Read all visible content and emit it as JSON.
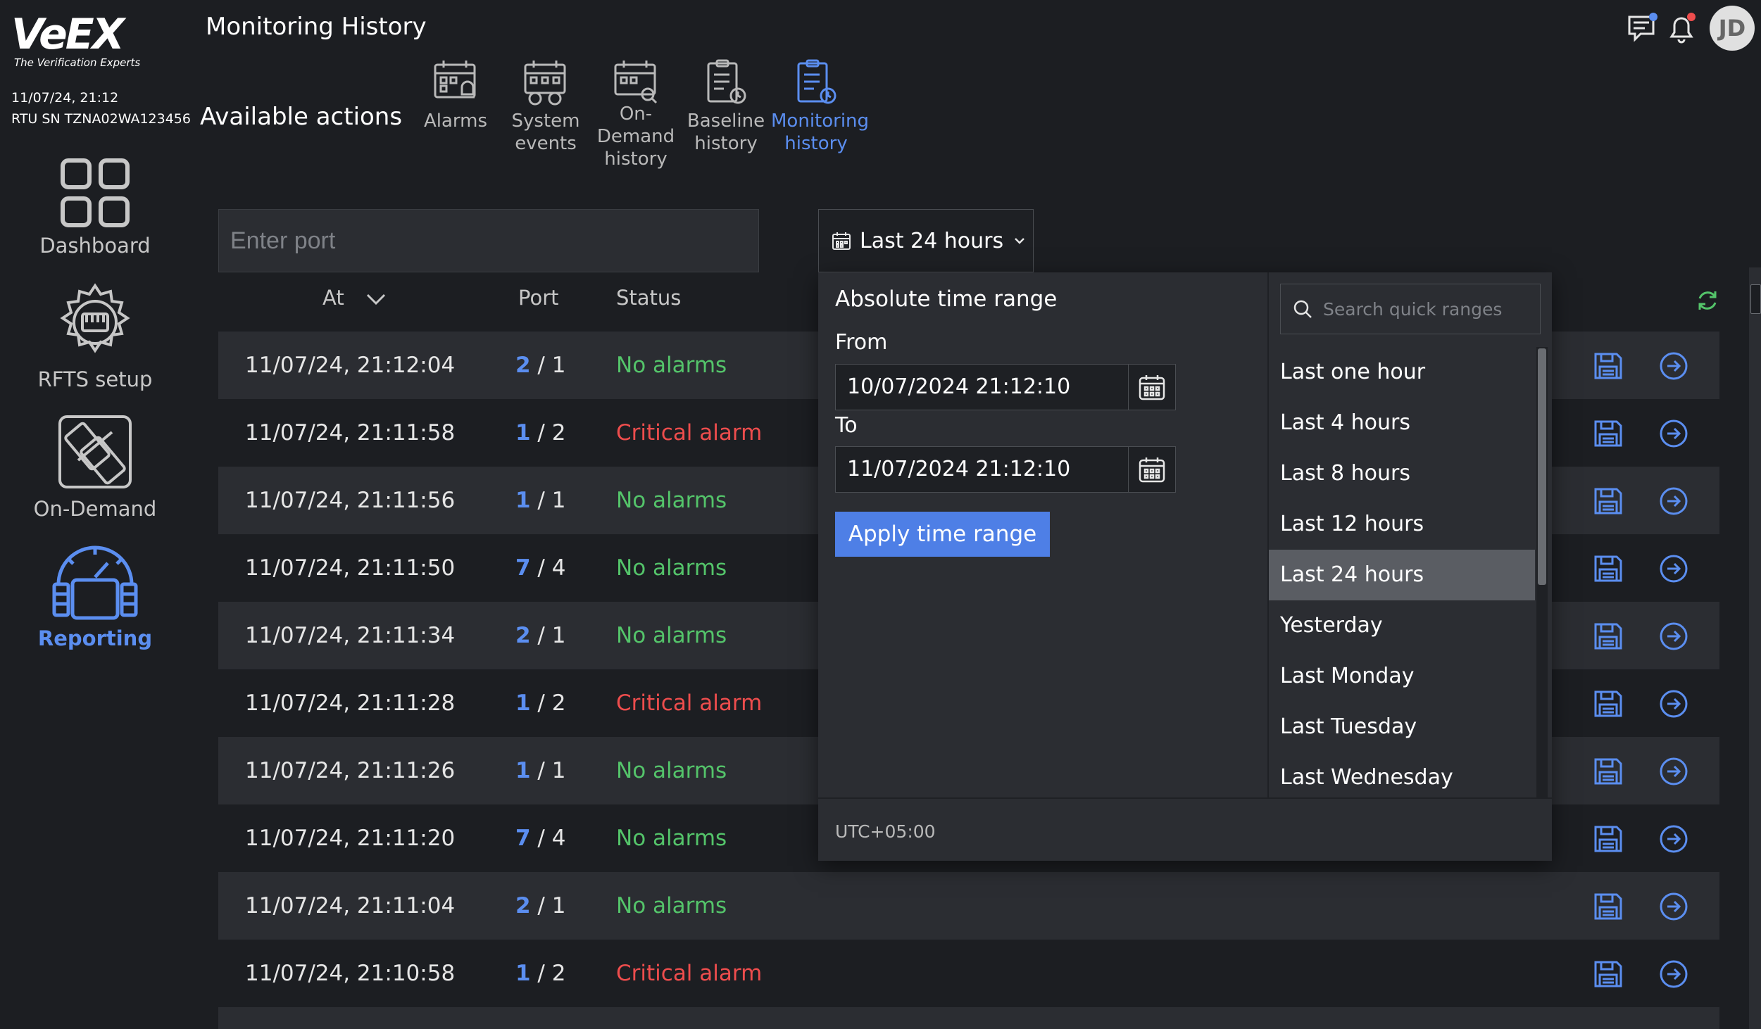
{
  "brand": {
    "name": "VeEX",
    "tagline": "The Verification Experts"
  },
  "device": {
    "datetime": "11/07/24, 21:12",
    "serial": "RTU SN TZNA02WA123456"
  },
  "sidebar": {
    "items": [
      {
        "label": "Dashboard",
        "icon": "grid-icon",
        "active": false
      },
      {
        "label": "RFTS setup",
        "icon": "gear-icon",
        "active": false
      },
      {
        "label": "On-Demand",
        "icon": "tools-icon",
        "active": false
      },
      {
        "label": "Reporting",
        "icon": "gauge-icon",
        "active": true
      }
    ]
  },
  "header": {
    "title": "Monitoring History",
    "user_initials": "JD"
  },
  "actions": {
    "title": "Available actions",
    "items": [
      {
        "label": "Alarms",
        "icon": "alarm-calendar-icon",
        "active": false
      },
      {
        "label": "System events",
        "icon": "system-events-icon",
        "active": false
      },
      {
        "label": "On-Demand history",
        "icon": "on-demand-history-icon",
        "active": false
      },
      {
        "label": "Baseline history",
        "icon": "baseline-history-icon",
        "active": false
      },
      {
        "label": "Monitoring history",
        "icon": "monitoring-history-icon",
        "active": true
      }
    ]
  },
  "filters": {
    "port_placeholder": "Enter port",
    "time_range": "Last 24 hours"
  },
  "table": {
    "columns": {
      "at": "At",
      "port": "Port",
      "status": "Status"
    },
    "rows": [
      {
        "at": "11/07/24, 21:12:04",
        "port_a": "2",
        "port_b": "1",
        "status": "No alarms",
        "level": "ok"
      },
      {
        "at": "11/07/24, 21:11:58",
        "port_a": "1",
        "port_b": "2",
        "status": "Critical alarm",
        "level": "critical"
      },
      {
        "at": "11/07/24, 21:11:56",
        "port_a": "1",
        "port_b": "1",
        "status": "No alarms",
        "level": "ok"
      },
      {
        "at": "11/07/24, 21:11:50",
        "port_a": "7",
        "port_b": "4",
        "status": "No alarms",
        "level": "ok"
      },
      {
        "at": "11/07/24, 21:11:34",
        "port_a": "2",
        "port_b": "1",
        "status": "No alarms",
        "level": "ok"
      },
      {
        "at": "11/07/24, 21:11:28",
        "port_a": "1",
        "port_b": "2",
        "status": "Critical alarm",
        "level": "critical"
      },
      {
        "at": "11/07/24, 21:11:26",
        "port_a": "1",
        "port_b": "1",
        "status": "No alarms",
        "level": "ok"
      },
      {
        "at": "11/07/24, 21:11:20",
        "port_a": "7",
        "port_b": "4",
        "status": "No alarms",
        "level": "ok"
      },
      {
        "at": "11/07/24, 21:11:04",
        "port_a": "2",
        "port_b": "1",
        "status": "No alarms",
        "level": "ok"
      },
      {
        "at": "11/07/24, 21:10:58",
        "port_a": "1",
        "port_b": "2",
        "status": "Critical alarm",
        "level": "critical"
      }
    ]
  },
  "time_picker": {
    "absolute_title": "Absolute time range",
    "from_label": "From",
    "from_value": "10/07/2024 21:12:10",
    "to_label": "To",
    "to_value": "11/07/2024 21:12:10",
    "apply_label": "Apply time range",
    "timezone": "UTC+05:00",
    "search_placeholder": "Search quick ranges",
    "quick_ranges": [
      "Last one hour",
      "Last 4 hours",
      "Last 8 hours",
      "Last 12 hours",
      "Last 24 hours",
      "Yesterday",
      "Last Monday",
      "Last Tuesday",
      "Last Wednesday"
    ],
    "selected": "Last 24 hours"
  },
  "colors": {
    "accent": "#5b8ef0",
    "ok": "#54c46a",
    "critical": "#ee4d4d",
    "background": "#1c1e22",
    "row_alt": "#2b2d32"
  }
}
